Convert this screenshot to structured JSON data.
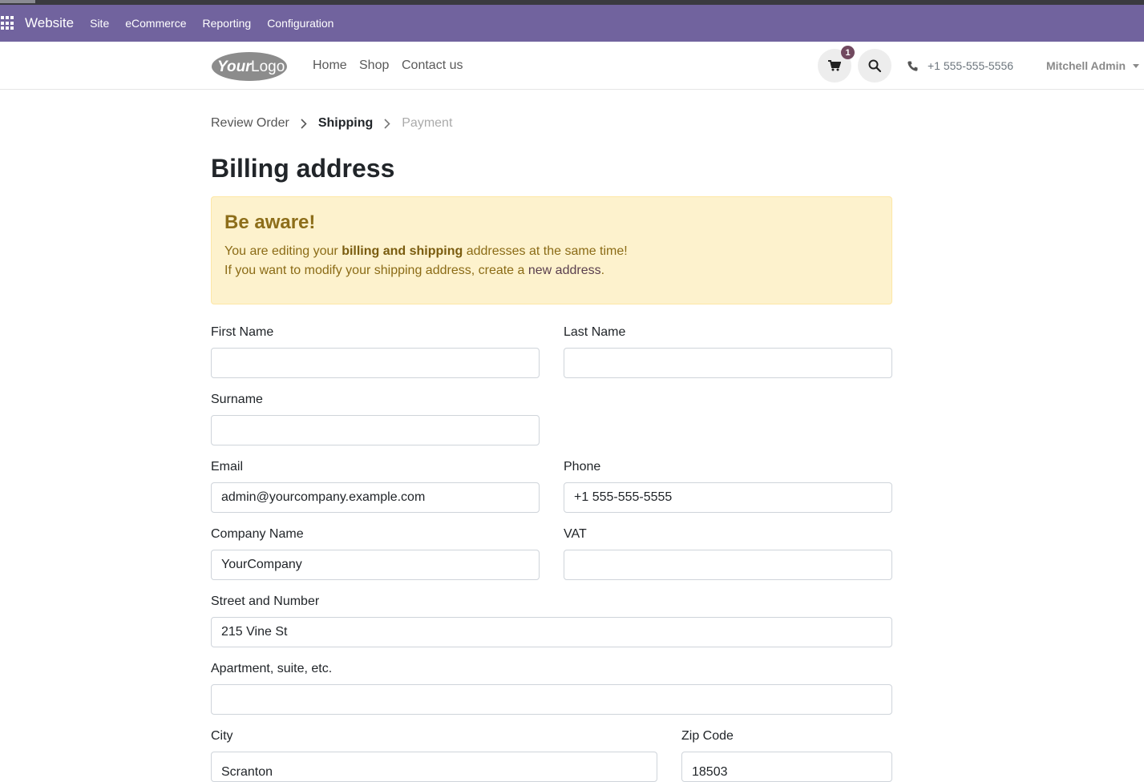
{
  "odoo_bar": {
    "brand": "Website",
    "menus": [
      "Site",
      "eCommerce",
      "Reporting",
      "Configuration"
    ]
  },
  "header": {
    "logo_text": "YourLogo",
    "nav": [
      "Home",
      "Shop",
      "Contact us"
    ],
    "cart_count": "1",
    "phone": "+1 555-555-5556",
    "user": "Mitchell Admin"
  },
  "checkout_steps": {
    "review": "Review Order",
    "shipping": "Shipping",
    "payment": "Payment"
  },
  "page_title": "Billing address",
  "alert": {
    "title": "Be aware!",
    "line1_prefix": "You are editing your ",
    "line1_bold": "billing and shipping",
    "line1_suffix": " addresses at the same time!",
    "line2_prefix": "If you want to modify your shipping address, create a ",
    "line2_link": "new address",
    "line2_suffix": "."
  },
  "form": {
    "first_name": {
      "label": "First Name",
      "value": ""
    },
    "last_name": {
      "label": "Last Name",
      "value": ""
    },
    "surname": {
      "label": "Surname",
      "value": ""
    },
    "email": {
      "label": "Email",
      "value": "admin@yourcompany.example.com"
    },
    "phone": {
      "label": "Phone",
      "value": "+1 555-555-5555"
    },
    "company": {
      "label": "Company Name",
      "value": "YourCompany"
    },
    "vat": {
      "label": "VAT",
      "value": ""
    },
    "street": {
      "label": "Street and Number",
      "value": "215 Vine St"
    },
    "street2": {
      "label": "Apartment, suite, etc.",
      "value": ""
    },
    "city": {
      "label": "City",
      "value": "Scranton"
    },
    "zip": {
      "label": "Zip Code",
      "value": "18503"
    }
  },
  "colors": {
    "odoo_bar": "#71639e",
    "alert_bg": "#fdf2cd",
    "alert_text": "#8b6b16",
    "cart_badge": "#71495f"
  }
}
